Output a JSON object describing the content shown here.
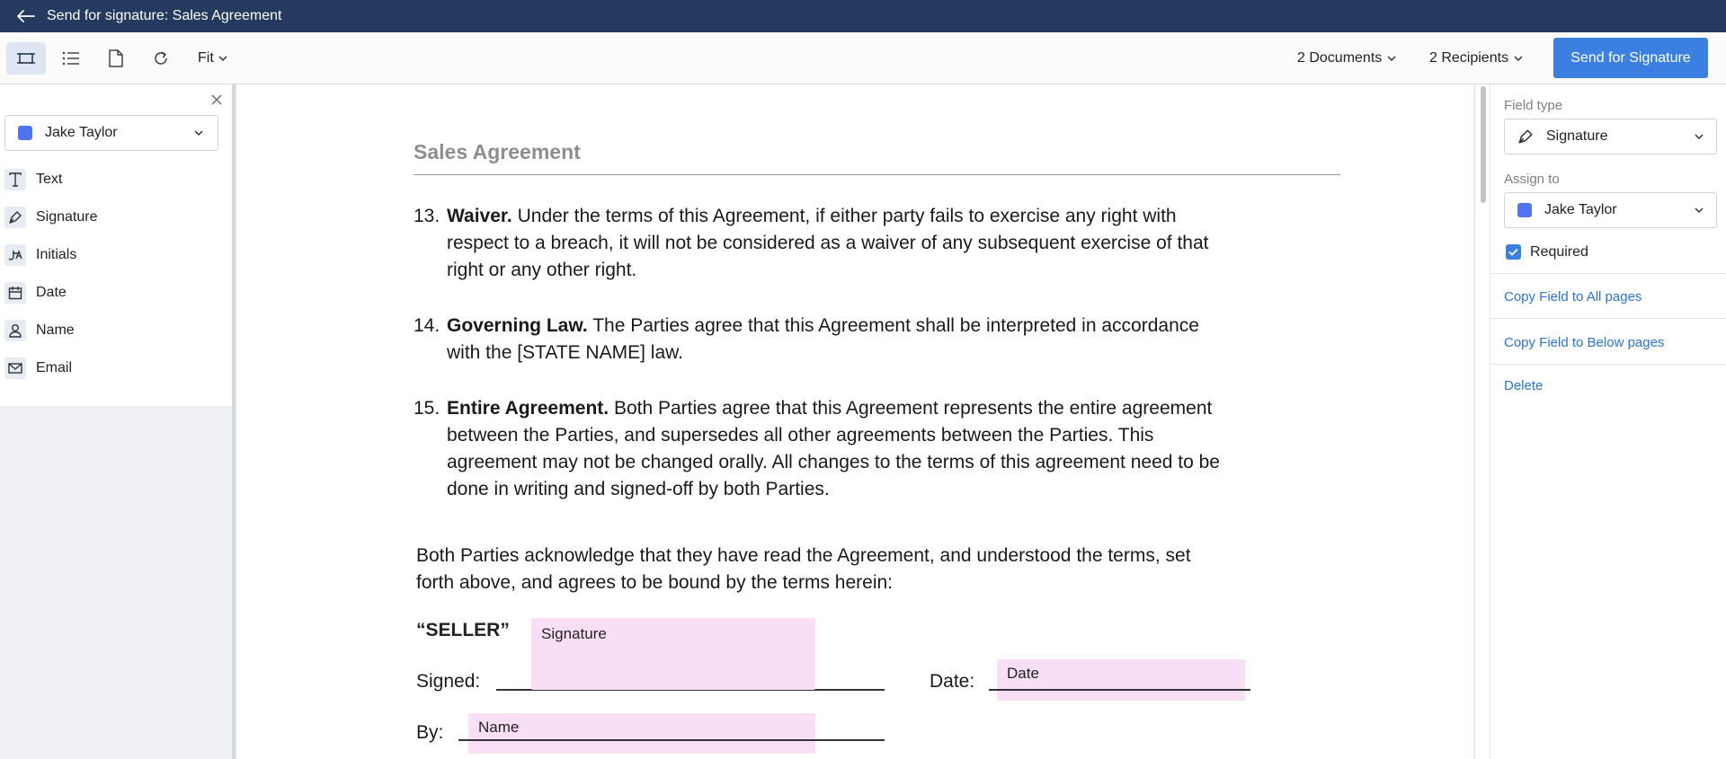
{
  "header": {
    "title": "Send for signature: Sales Agreement"
  },
  "toolbar": {
    "zoom_label": "Fit",
    "documents_label": "2 Documents",
    "recipients_label": "2 Recipients",
    "send_label": "Send for Signature"
  },
  "left_panel": {
    "recipient": "Jake Taylor",
    "recipient_color": "#5273ee",
    "tools": [
      {
        "label": "Text",
        "icon": "text-icon"
      },
      {
        "label": "Signature",
        "icon": "pen-icon"
      },
      {
        "label": "Initials",
        "icon": "initials-icon"
      },
      {
        "label": "Date",
        "icon": "calendar-icon"
      },
      {
        "label": "Name",
        "icon": "person-icon"
      },
      {
        "label": "Email",
        "icon": "envelope-icon"
      }
    ]
  },
  "document": {
    "title": "Sales Agreement",
    "clauses": [
      {
        "num": "13.",
        "heading": "Waiver.",
        "lines": [
          " Under the terms of this Agreement, if either party fails to exercise any right with",
          "respect to a breach, it will not be considered as a waiver of any subsequent exercise of that",
          "right or any other right."
        ]
      },
      {
        "num": "14.",
        "heading": "Governing Law.",
        "lines": [
          " The Parties agree that this Agreement shall be interpreted in accordance",
          "with the [STATE NAME] law."
        ]
      },
      {
        "num": "15.",
        "heading": "Entire Agreement.",
        "lines": [
          " Both Parties agree that this Agreement represents the entire agreement",
          "between the Parties, and supersedes all other agreements between the Parties. This",
          "agreement may not be changed orally. All changes to the terms of this agreement need to be",
          "done in writing and signed-off by both Parties."
        ]
      }
    ],
    "acknowledgement_line1": "Both Parties acknowledge that they have read the Agreement, and understood the terms, set",
    "acknowledgement_line2": "forth above, and agrees to be bound by the terms herein:",
    "seller_label": "“SELLER”",
    "signed_label": "Signed:",
    "date_label": "Date:",
    "by_label": "By:",
    "fields": {
      "signature": "Signature",
      "date": "Date",
      "name": "Name"
    },
    "field_color": "#f9dff5"
  },
  "right_panel": {
    "field_type_label": "Field type",
    "field_type_value": "Signature",
    "assign_to_label": "Assign to",
    "assign_to_value": "Jake Taylor",
    "required_label": "Required",
    "required": true,
    "copy_all": "Copy Field to All pages",
    "copy_below": "Copy Field to Below pages",
    "delete": "Delete"
  },
  "colors": {
    "header_bg": "#243a5e",
    "accent": "#3b80e0",
    "link": "#2a74d3"
  }
}
